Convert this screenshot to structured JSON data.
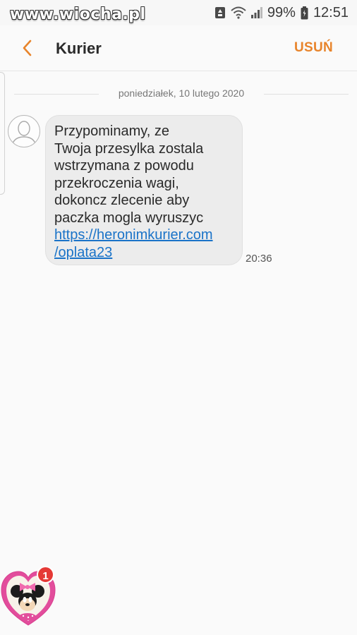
{
  "status_bar": {
    "watermark": "www.wiocha.pl",
    "battery_percent": "99%",
    "time": "12:51"
  },
  "header": {
    "title": "Kurier",
    "delete_label": "USUŃ"
  },
  "conversation": {
    "date_separator": "poniedziałek, 10 lutego 2020",
    "message": {
      "lines": [
        "Przypominamy, ze",
        "Twoja przesylka zostala",
        "wstrzymana z powodu",
        "przekroczenia wagi,",
        "dokoncz zlecenie aby",
        "paczka mogla wyruszyc"
      ],
      "link_lines": [
        "https://heronimkurier.com",
        "/oplata23"
      ],
      "time": "20:36"
    }
  },
  "chat_head": {
    "badge_count": "1"
  },
  "colors": {
    "accent": "#e8842b",
    "link": "#1a73c8",
    "bubble": "#ececec",
    "badge": "#e53935"
  },
  "icons": [
    "notification-icon",
    "save-mode-icon",
    "wifi-icon",
    "signal-icon",
    "battery-icon",
    "back-chevron-icon",
    "contact-avatar-icon"
  ]
}
